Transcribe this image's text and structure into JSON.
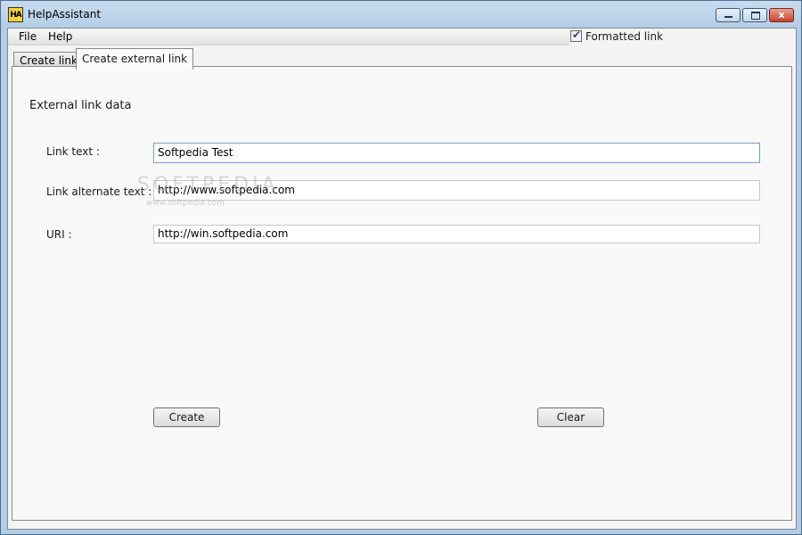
{
  "window": {
    "title": "HelpAssistant",
    "icon_text": "HA",
    "close_glyph": "x"
  },
  "menu": {
    "items": [
      {
        "label": "File"
      },
      {
        "label": "Help"
      }
    ]
  },
  "options": {
    "formatted_link_label": "Formatted link",
    "formatted_link_checked": true,
    "check_glyph": "✔"
  },
  "tabs": [
    {
      "label": "Create link",
      "active": false
    },
    {
      "label": "Create external link",
      "active": true
    }
  ],
  "external_link": {
    "section_title": "External link data",
    "link_text_label": "Link text :",
    "link_text_value": "Softpedia Test",
    "link_alt_label": "Link alternate text :",
    "link_alt_value": "http://www.softpedia.com",
    "uri_label": "URI :",
    "uri_value": "http://win.softpedia.com"
  },
  "buttons": {
    "create": "Create",
    "clear": "Clear"
  },
  "watermark": {
    "main": "SOFTPEDIA",
    "sub": "www.softpedia.com"
  },
  "icons": {
    "app": "help-assistant-app-icon",
    "minimize": "minimize-icon",
    "maximize": "maximize-icon",
    "close": "close-icon"
  }
}
